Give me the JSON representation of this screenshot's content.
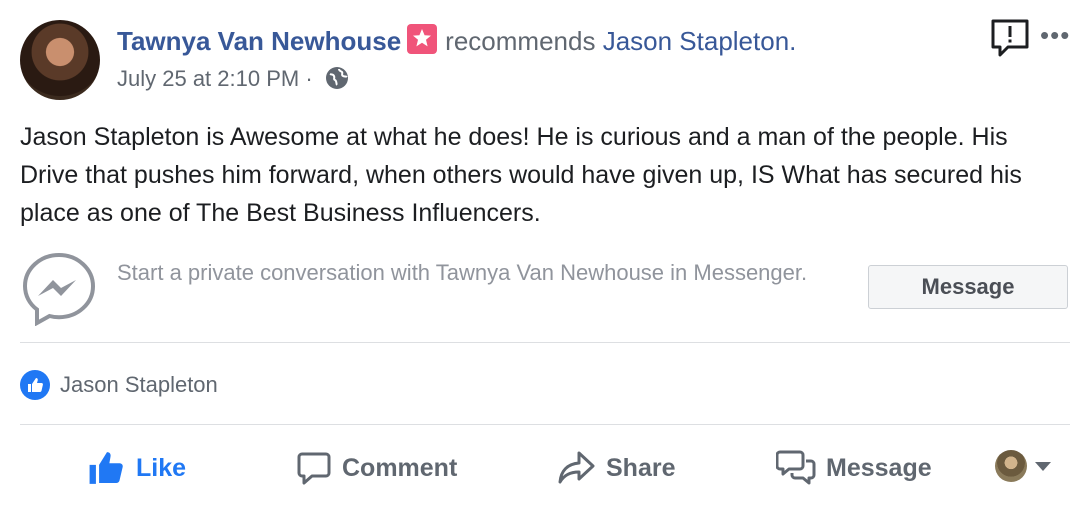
{
  "post": {
    "author": "Tawnya Van Newhouse",
    "verb": "recommends",
    "target": "Jason Stapleton.",
    "timestamp": "July 25 at 2:10 PM",
    "separator": "·",
    "body": "Jason Stapleton is Awesome at what he does! He is curious and a man of the people. His Drive that pushes him forward, when others would have given up, IS What has secured his place as one of The Best Business Influencers.",
    "more_label": "•••"
  },
  "messenger": {
    "prompt": "Start a private conversation with Tawnya Van Newhouse in Messenger.",
    "button_label": "Message"
  },
  "reactions": {
    "likers": "Jason Stapleton"
  },
  "actions": {
    "like": "Like",
    "comment": "Comment",
    "share": "Share",
    "message": "Message"
  },
  "colors": {
    "link": "#385898",
    "like_blue": "#2078f4",
    "recommend_badge": "#f0547a",
    "muted": "#606770"
  }
}
